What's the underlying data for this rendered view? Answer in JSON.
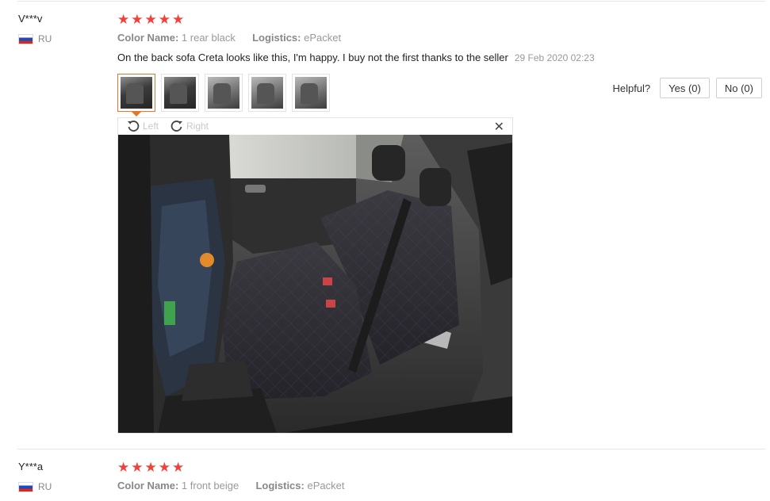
{
  "reviews": [
    {
      "user": "V***v",
      "country": "RU",
      "stars": 5,
      "color_key": "Color Name:",
      "color_value": "1 rear black",
      "logistics_key": "Logistics:",
      "logistics_value": "ePacket",
      "text": "On the back sofa Creta looks like this, I'm happy. I buy not the first thanks to the seller",
      "time": "29 Feb 2020 02:23",
      "helpful_label": "Helpful?",
      "yes_label": "Yes (0)",
      "no_label": "No (0)",
      "viewer": {
        "left_label": "Left",
        "right_label": "Right",
        "close_glyph": "✕"
      }
    },
    {
      "user": "Y***a",
      "country": "RU",
      "stars": 5,
      "color_key": "Color Name:",
      "color_value": "1 front beige",
      "logistics_key": "Logistics:",
      "logistics_value": "ePacket"
    }
  ],
  "icons": {
    "star": "star-icon",
    "flag": "russia-flag-icon",
    "rotate_left": "rotate-left-icon",
    "rotate_right": "rotate-right-icon",
    "close": "close-icon"
  },
  "colors": {
    "star": "#f0423a",
    "active_thumb_border": "#e07a2a"
  }
}
